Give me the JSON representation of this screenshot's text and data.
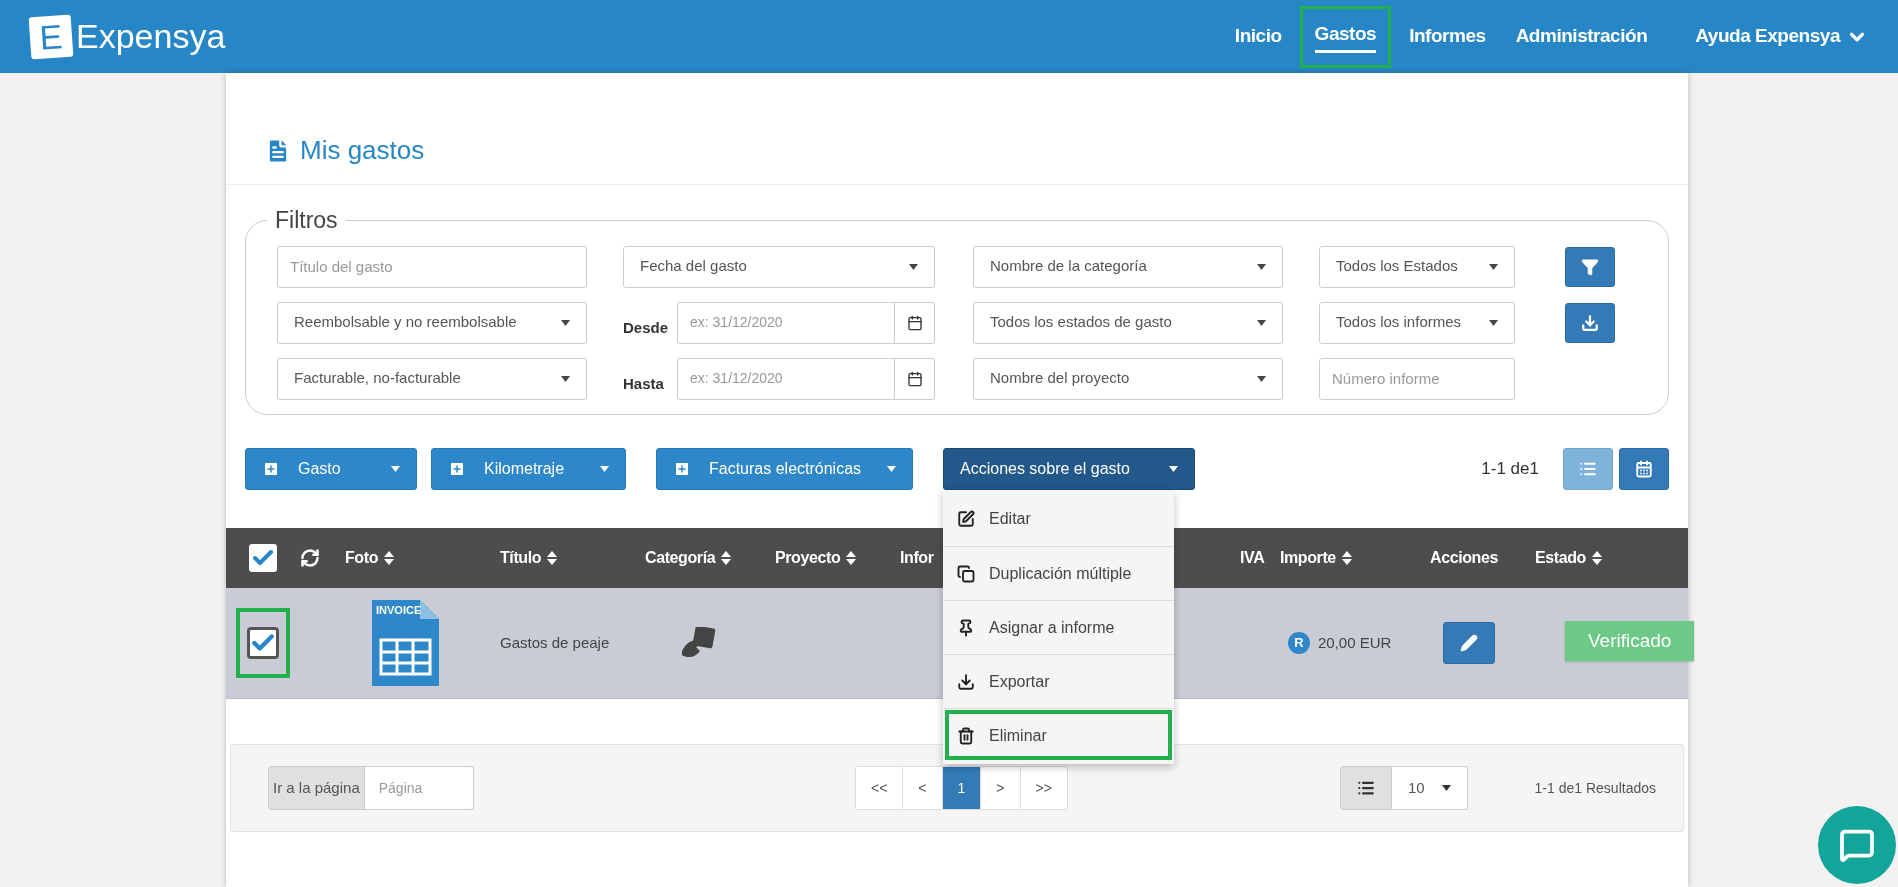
{
  "brand": {
    "letter": "E",
    "name": "Expensya"
  },
  "nav": [
    {
      "label": "Inicio",
      "selected": false,
      "highlighted": false
    },
    {
      "label": "Gastos",
      "selected": true,
      "highlighted": true
    },
    {
      "label": "Informes",
      "selected": false,
      "highlighted": false
    },
    {
      "label": "Administración",
      "selected": false,
      "highlighted": false
    }
  ],
  "help_menu": {
    "label": "Ayuda Expensya"
  },
  "page_title": "Mis gastos",
  "filters": {
    "legend": "Filtros",
    "fields": [
      {
        "kind": "input",
        "placeholder": "Título del gasto"
      },
      {
        "kind": "select",
        "value": "Fecha del gasto"
      },
      {
        "kind": "select",
        "value": "Nombre de la categoría"
      },
      {
        "kind": "select",
        "value": "Todos los Estados"
      },
      {
        "kind": "select",
        "value": "Reembolsable y no reembolsable"
      },
      {
        "kind": "date",
        "label": "Desde",
        "placeholder": "ex: 31/12/2020"
      },
      {
        "kind": "select",
        "value": "Todos los estados de gasto"
      },
      {
        "kind": "select",
        "value": "Todos los informes"
      },
      {
        "kind": "select",
        "value": "Facturable, no-facturable"
      },
      {
        "kind": "date",
        "label": "Hasta",
        "placeholder": "ex: 31/12/2020"
      },
      {
        "kind": "select",
        "value": "Nombre del proyecto"
      },
      {
        "kind": "input",
        "placeholder": "Número informe"
      }
    ]
  },
  "toolbar": {
    "buttons": [
      {
        "label": "Gasto",
        "kind": "add"
      },
      {
        "label": "Kilometraje",
        "kind": "add"
      },
      {
        "label": "Facturas electrónicas",
        "kind": "add"
      },
      {
        "label": "Acciones sobre el gasto",
        "kind": "actions"
      }
    ],
    "count": "1-1 de1",
    "views": [
      {
        "kind": "list",
        "selected": true
      },
      {
        "kind": "calendar",
        "selected": false
      }
    ]
  },
  "actions_menu": [
    {
      "label": "Editar",
      "kind": "edit",
      "highlighted": false
    },
    {
      "label": "Duplicación múltiple",
      "kind": "duplicate",
      "highlighted": false
    },
    {
      "label": "Asignar a informe",
      "kind": "assign",
      "highlighted": false
    },
    {
      "label": "Exportar",
      "kind": "export",
      "highlighted": false
    },
    {
      "label": "Eliminar",
      "kind": "delete",
      "highlighted": true
    }
  ],
  "table": {
    "select_all": {
      "checked": true
    },
    "columns": [
      {
        "label": "Foto",
        "sortable": true
      },
      {
        "label": "Título",
        "sortable": true
      },
      {
        "label": "Categoría",
        "sortable": true
      },
      {
        "label": "Proyecto",
        "sortable": true
      },
      {
        "label": "Infor",
        "sortable": false
      },
      {
        "label": "IVA",
        "sortable": false
      },
      {
        "label": "Importe",
        "sortable": true
      },
      {
        "label": "Acciones",
        "sortable": false
      },
      {
        "label": "Estado",
        "sortable": true
      }
    ],
    "rows": [
      {
        "checked": true,
        "highlighted": true,
        "thumbnail_label": "INVOICE",
        "title": "Gastos de peaje",
        "refund_mark": "R",
        "amount": "20,00 EUR",
        "status": "Verificado"
      }
    ]
  },
  "pagination": {
    "goto_label": "Ir a la página",
    "goto_placeholder": "Página",
    "pages": [
      {
        "label": "<<",
        "selected": false
      },
      {
        "label": "<",
        "selected": false
      },
      {
        "label": "1",
        "selected": true
      },
      {
        "label": ">",
        "selected": false
      },
      {
        "label": ">>",
        "selected": false
      }
    ],
    "page_size": "10",
    "summary": "1-1 de1 Resultados"
  }
}
